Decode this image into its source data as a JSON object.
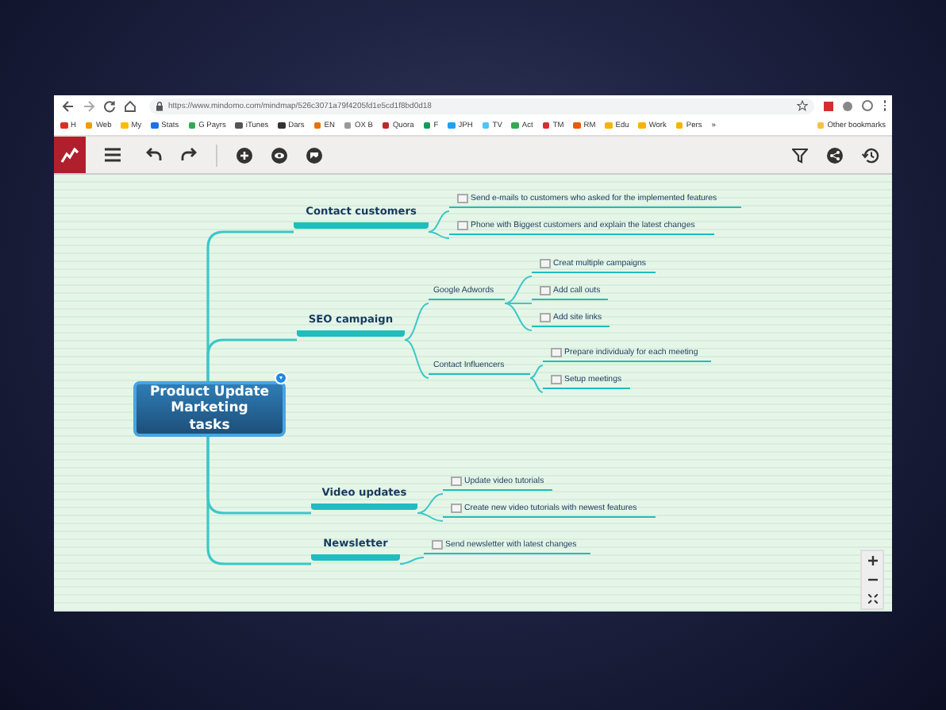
{
  "browser": {
    "url": "https://www.mindomo.com/mindmap/526c3071a79f4205fd1e5cd1f8bd0d18",
    "bookmarks": [
      "H",
      "Web",
      "My",
      "Stats",
      "G Payrs",
      "iTunes",
      "Dars",
      "EN",
      "OX B",
      "Quora",
      "F",
      "JPH",
      "TV",
      "Act",
      "TM",
      "RM",
      "Edu",
      "Work",
      "Pers"
    ],
    "more": "»",
    "other_bookmarks": "Other bookmarks"
  },
  "mindmap": {
    "central": "Product Update Marketing tasks",
    "branches": [
      {
        "title": "Contact customers",
        "children": [
          {
            "kind": "task",
            "label": "Send e-mails to customers who asked for the implemented features",
            "checked": false
          },
          {
            "kind": "task",
            "label": "Phone with Biggest customers and explain the latest changes",
            "checked": false
          }
        ]
      },
      {
        "title": "SEO campaign",
        "children": [
          {
            "kind": "group",
            "label": "Google Adwords",
            "children": [
              {
                "kind": "task",
                "label": "Creat multiple campaigns",
                "checked": false
              },
              {
                "kind": "task",
                "label": "Add call outs",
                "checked": false
              },
              {
                "kind": "task",
                "label": "Add site links",
                "checked": false
              }
            ]
          },
          {
            "kind": "group",
            "label": "Contact Influencers",
            "children": [
              {
                "kind": "task",
                "label": "Prepare individualy for each meeting",
                "checked": false
              },
              {
                "kind": "task",
                "label": "Setup meetings",
                "checked": false
              }
            ]
          }
        ]
      },
      {
        "title": "Video updates",
        "children": [
          {
            "kind": "task",
            "label": "Update video tutorials",
            "checked": false
          },
          {
            "kind": "task",
            "label": "Create new video tutorials with newest features",
            "checked": false
          }
        ]
      },
      {
        "title": "Newsletter",
        "children": [
          {
            "kind": "task",
            "label": "Send newsletter with latest changes",
            "checked": false
          }
        ]
      }
    ]
  }
}
